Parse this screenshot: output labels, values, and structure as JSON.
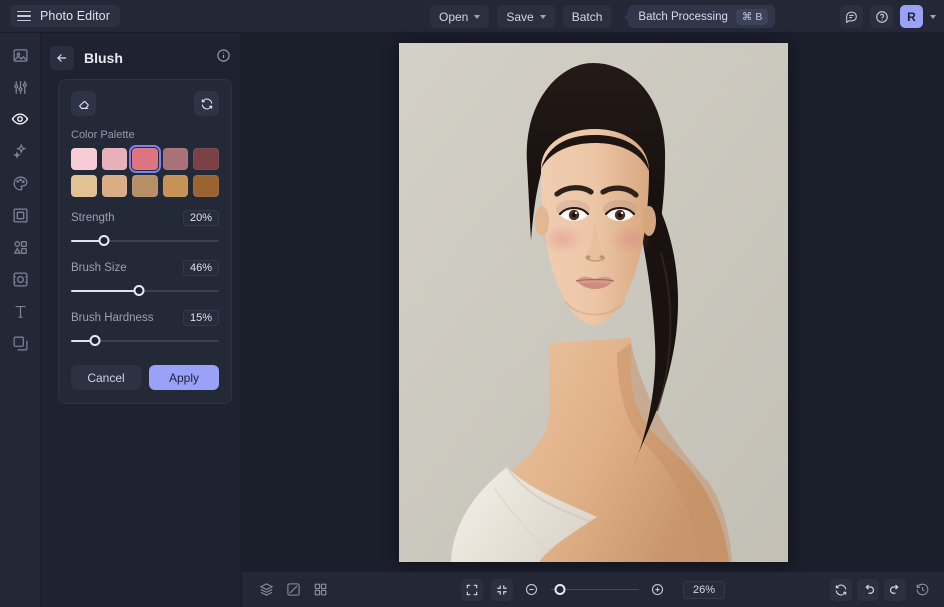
{
  "app": {
    "title": "Photo Editor"
  },
  "topbar": {
    "open_label": "Open",
    "save_label": "Save",
    "batch_label": "Batch",
    "tooltip_text": "Batch Processing",
    "tooltip_shortcut": "⌘ B",
    "avatar_initial": "R"
  },
  "sidebar": {
    "items": [
      {
        "name": "image-icon"
      },
      {
        "name": "adjustments-icon"
      },
      {
        "name": "eye-icon",
        "active": true
      },
      {
        "name": "sparkles-icon"
      },
      {
        "name": "palette-icon"
      },
      {
        "name": "frame-icon"
      },
      {
        "name": "shapes-icon"
      },
      {
        "name": "effects-icon"
      },
      {
        "name": "text-icon"
      },
      {
        "name": "layers-icon"
      }
    ]
  },
  "panel": {
    "title": "Blush",
    "palette_label": "Color Palette",
    "swatches": [
      [
        {
          "color": "#f7ccd4",
          "selected": false
        },
        {
          "color": "#e8b0b8",
          "selected": false
        },
        {
          "color": "#dd7480",
          "selected": true
        },
        {
          "color": "#a9727a",
          "selected": false
        },
        {
          "color": "#7a4246",
          "selected": false
        }
      ],
      [
        {
          "color": "#e2c193",
          "selected": false
        },
        {
          "color": "#d9ae85",
          "selected": false
        },
        {
          "color": "#b78f67",
          "selected": false
        },
        {
          "color": "#c79256",
          "selected": false
        },
        {
          "color": "#9a6430",
          "selected": false
        }
      ]
    ],
    "sliders": [
      {
        "label": "Strength",
        "value": "20%",
        "percent": 22
      },
      {
        "label": "Brush Size",
        "value": "46%",
        "percent": 46
      },
      {
        "label": "Brush Hardness",
        "value": "15%",
        "percent": 16
      }
    ],
    "cancel_label": "Cancel",
    "apply_label": "Apply"
  },
  "bottombar": {
    "zoom_value": "26%",
    "zoom_percent": 10
  },
  "colors": {
    "accent": "#9aa2f7",
    "selection_ring": "#7b83f0",
    "panel_bg": "#1f2331",
    "chrome_bg": "#242836",
    "canvas_bg": "#1b1e2b"
  }
}
